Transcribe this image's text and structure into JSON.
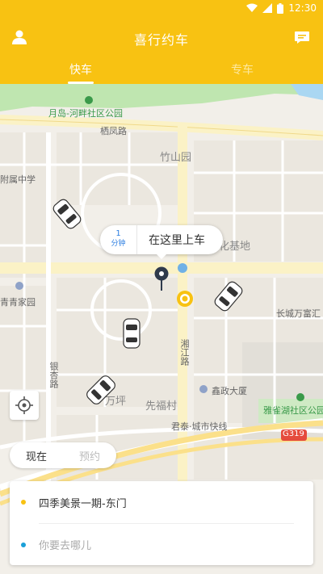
{
  "status_bar": {
    "time": "12:30"
  },
  "header": {
    "title": "喜行约车"
  },
  "tabs": [
    {
      "label": "快车",
      "active": true
    },
    {
      "label": "专车",
      "active": false
    }
  ],
  "map": {
    "labels": {
      "park": "月岛-河畔社区公园",
      "road_qifeng": "栖凤路",
      "zhushanyuan": "竹山园",
      "school": "附属中学",
      "culture_base": "文化基地",
      "qingqing": "青青家园",
      "changcheng": "长城万富汇",
      "road_xiewei": "湘江路",
      "xinzheng": "鑫政大厦",
      "yaque_park": "雅雀湖社区公园",
      "wanping": "万坪",
      "xianfu": "先福村",
      "junta": "君泰·城市快线",
      "highway": "G319",
      "road_bottom": "银杏路"
    }
  },
  "pickup": {
    "eta_value": "1",
    "eta_unit": "分钟",
    "text": "在这里上车"
  },
  "mode_toggle": {
    "now": "现在",
    "reserve": "预约"
  },
  "address": {
    "from": "四季美景一期-东门",
    "to_placeholder": "你要去哪儿"
  },
  "colors": {
    "brand": "#f8c212",
    "accent_blue": "#1aa0d8"
  }
}
